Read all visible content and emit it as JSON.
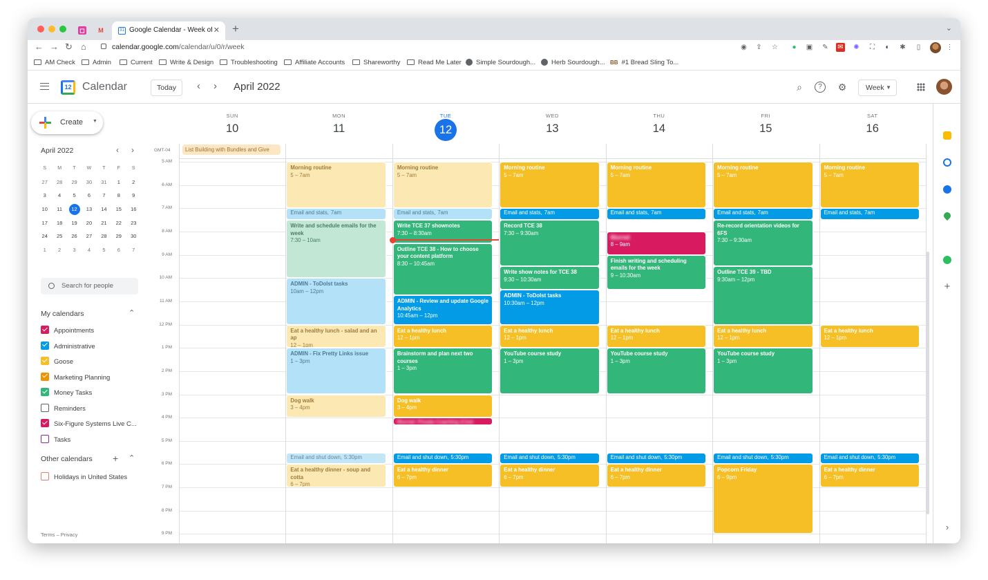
{
  "browser": {
    "tab_title": "Google Calendar - Week of Ap",
    "url_host": "calendar.google.com",
    "url_path": "/calendar/u/0/r/week",
    "bookmarks": [
      "AM Check",
      "Admin",
      "Current",
      "Write & Design",
      "Troubleshooting",
      "Affiliate Accounts",
      "Shareworthy",
      "Read Me Later",
      "Simple Sourdough...",
      "Herb Sourdough...",
      "#1 Bread Sling To..."
    ]
  },
  "header": {
    "app_name": "Calendar",
    "logo_day": "12",
    "today_label": "Today",
    "month_title": "April 2022",
    "view_label": "Week"
  },
  "sidebar": {
    "create_label": "Create",
    "mini_month": "April 2022",
    "dow": [
      "S",
      "M",
      "T",
      "W",
      "T",
      "F",
      "S"
    ],
    "weeks": [
      [
        "27",
        "28",
        "29",
        "30",
        "31",
        "1",
        "2"
      ],
      [
        "3",
        "4",
        "5",
        "6",
        "7",
        "8",
        "9"
      ],
      [
        "10",
        "11",
        "12",
        "13",
        "14",
        "15",
        "16"
      ],
      [
        "17",
        "18",
        "19",
        "20",
        "21",
        "22",
        "23"
      ],
      [
        "24",
        "25",
        "26",
        "27",
        "28",
        "29",
        "30"
      ],
      [
        "1",
        "2",
        "3",
        "4",
        "5",
        "6",
        "7"
      ]
    ],
    "search_placeholder": "Search for people",
    "my_calendars_title": "My calendars",
    "my_calendars": [
      {
        "name": "Appointments",
        "color": "#d81b60",
        "checked": true
      },
      {
        "name": "Administrative",
        "color": "#039be5",
        "checked": true
      },
      {
        "name": "Goose",
        "color": "#f6bf26",
        "checked": true
      },
      {
        "name": "Marketing Planning",
        "color": "#f09300",
        "checked": true
      },
      {
        "name": "Money Tasks",
        "color": "#33b679",
        "checked": true
      },
      {
        "name": "Reminders",
        "color": "#616161",
        "checked": false
      },
      {
        "name": "Six-Figure Systems Live C...",
        "color": "#d81b60",
        "checked": true
      },
      {
        "name": "Tasks",
        "color": "#8e24aa",
        "checked": false
      }
    ],
    "other_calendars_title": "Other calendars",
    "other_calendars": [
      {
        "name": "Holidays in United States",
        "color": "#e67c73",
        "checked": false
      }
    ],
    "footer": "Terms – Privacy"
  },
  "week": {
    "days": [
      {
        "dow": "SUN",
        "num": "10"
      },
      {
        "dow": "MON",
        "num": "11"
      },
      {
        "dow": "TUE",
        "num": "12",
        "today": true
      },
      {
        "dow": "WED",
        "num": "13"
      },
      {
        "dow": "THU",
        "num": "14"
      },
      {
        "dow": "FRI",
        "num": "15"
      },
      {
        "dow": "SAT",
        "num": "16"
      }
    ],
    "timezone": "GMT-04",
    "times": [
      "5 AM",
      "6 AM",
      "7 AM",
      "8 AM",
      "9 AM",
      "10 AM",
      "11 AM",
      "12 PM",
      "1 PM",
      "2 PM",
      "3 PM",
      "4 PM",
      "5 PM",
      "6 PM",
      "7 PM",
      "8 PM",
      "9 PM"
    ],
    "all_day_event": "List Building with Bundles and Give",
    "events": [
      {
        "day": 1,
        "start": 5,
        "end": 7,
        "title": "Morning routine",
        "time": "5 – 7am",
        "style": "c-yp"
      },
      {
        "day": 2,
        "start": 5,
        "end": 7,
        "title": "Morning routine",
        "time": "5 – 7am",
        "style": "c-yp"
      },
      {
        "day": 3,
        "start": 5,
        "end": 7,
        "title": "Morning routine",
        "time": "5 – 7am",
        "style": "c-y"
      },
      {
        "day": 4,
        "start": 5,
        "end": 7,
        "title": "Morning routine",
        "time": "5 – 7am",
        "style": "c-y"
      },
      {
        "day": 5,
        "start": 5,
        "end": 7,
        "title": "Morning routine",
        "time": "5 – 7am",
        "style": "c-y"
      },
      {
        "day": 6,
        "start": 5,
        "end": 7,
        "title": "Morning routine",
        "time": "5 – 7am",
        "style": "c-y"
      },
      {
        "day": 1,
        "start": 7,
        "end": 7.5,
        "title": "Email and stats,",
        "time": "7am",
        "inline": true,
        "style": "c-bp"
      },
      {
        "day": 2,
        "start": 7,
        "end": 7.5,
        "title": "Email and stats,",
        "time": "7am",
        "inline": true,
        "style": "c-bp"
      },
      {
        "day": 3,
        "start": 7,
        "end": 7.5,
        "title": "Email and stats,",
        "time": "7am",
        "inline": true,
        "style": "c-b"
      },
      {
        "day": 4,
        "start": 7,
        "end": 7.5,
        "title": "Email and stats,",
        "time": "7am",
        "inline": true,
        "style": "c-b"
      },
      {
        "day": 5,
        "start": 7,
        "end": 7.5,
        "title": "Email and stats,",
        "time": "7am",
        "inline": true,
        "style": "c-b"
      },
      {
        "day": 6,
        "start": 7,
        "end": 7.5,
        "title": "Email and stats,",
        "time": "7am",
        "inline": true,
        "style": "c-b"
      },
      {
        "day": 1,
        "start": 7.5,
        "end": 10,
        "title": "Write and schedule emails for the week",
        "time": "7:30 – 10am",
        "style": "c-gp"
      },
      {
        "day": 2,
        "start": 7.5,
        "end": 8.5,
        "title": "Write TCE 37 shownotes",
        "time": "7:30 – 8:30am",
        "style": "c-g"
      },
      {
        "day": 2,
        "start": 8.5,
        "end": 10.75,
        "title": "Outline TCE 38 - How to choose your content platform",
        "time": "8:30 – 10:45am",
        "style": "c-g"
      },
      {
        "day": 2,
        "start": 10.75,
        "end": 12,
        "title": "ADMIN - Review and update Google Analytics",
        "time": "10:45am – 12pm",
        "style": "c-b"
      },
      {
        "day": 3,
        "start": 7.5,
        "end": 9.5,
        "title": "Record TCE 38",
        "time": "7:30 – 9:30am",
        "style": "c-g"
      },
      {
        "day": 3,
        "start": 9.5,
        "end": 10.5,
        "title": "Write show notes for TCE 38",
        "time": "9:30 – 10:30am",
        "style": "c-g"
      },
      {
        "day": 3,
        "start": 10.5,
        "end": 12,
        "title": "ADMIN - ToDoIst tasks",
        "time": "10:30am – 12pm",
        "style": "c-b"
      },
      {
        "day": 4,
        "start": 8,
        "end": 9,
        "title": "Blurred",
        "time": "8 – 9am",
        "style": "c-r"
      },
      {
        "day": 4,
        "start": 9,
        "end": 10.5,
        "title": "Finish writing and scheduling emails for the week",
        "time": "9 – 10:30am",
        "style": "c-g"
      },
      {
        "day": 5,
        "start": 7.5,
        "end": 9.5,
        "title": "Re-record orientation videos for 6FS",
        "time": "7:30 – 9:30am",
        "style": "c-g"
      },
      {
        "day": 5,
        "start": 9.5,
        "end": 12,
        "title": "Outline TCE 39 - TBD",
        "time": "9:30am – 12pm",
        "style": "c-g"
      },
      {
        "day": 1,
        "start": 10,
        "end": 12,
        "title": "ADMIN - ToDoIst tasks",
        "time": "10am – 12pm",
        "style": "c-bp"
      },
      {
        "day": 1,
        "start": 12,
        "end": 13,
        "title": "Eat a healthy lunch - salad and an ap",
        "time": "12 – 1pm",
        "style": "c-yp"
      },
      {
        "day": 2,
        "start": 12,
        "end": 13,
        "title": "Eat a healthy lunch",
        "time": "12 – 1pm",
        "style": "c-y"
      },
      {
        "day": 3,
        "start": 12,
        "end": 13,
        "title": "Eat a healthy lunch",
        "time": "12 – 1pm",
        "style": "c-y"
      },
      {
        "day": 4,
        "start": 12,
        "end": 13,
        "title": "Eat a healthy lunch",
        "time": "12 – 1pm",
        "style": "c-y"
      },
      {
        "day": 5,
        "start": 12,
        "end": 13,
        "title": "Eat a healthy lunch",
        "time": "12 – 1pm",
        "style": "c-y"
      },
      {
        "day": 6,
        "start": 12,
        "end": 13,
        "title": "Eat a healthy lunch",
        "time": "12 – 1pm",
        "style": "c-y"
      },
      {
        "day": 1,
        "start": 13,
        "end": 15,
        "title": "ADMIN - Fix Pretty Links issue",
        "time": "1 – 3pm",
        "style": "c-bp"
      },
      {
        "day": 2,
        "start": 13,
        "end": 15,
        "title": "Brainstorm and plan next two courses",
        "time": "1 – 3pm",
        "style": "c-g"
      },
      {
        "day": 3,
        "start": 13,
        "end": 15,
        "title": "YouTube course study",
        "time": "1 – 3pm",
        "style": "c-g"
      },
      {
        "day": 4,
        "start": 13,
        "end": 15,
        "title": "YouTube course study",
        "time": "1 – 3pm",
        "style": "c-g"
      },
      {
        "day": 5,
        "start": 13,
        "end": 15,
        "title": "YouTube course study",
        "time": "1 – 3pm",
        "style": "c-g"
      },
      {
        "day": 1,
        "start": 15,
        "end": 16,
        "title": "Dog walk",
        "time": "3 – 4pm",
        "style": "c-yp"
      },
      {
        "day": 2,
        "start": 15,
        "end": 16,
        "title": "Dog walk",
        "time": "3 – 4pm",
        "style": "c-y"
      },
      {
        "day": 2,
        "start": 16,
        "end": 16.33,
        "title": "Blurred: Private Coaching (Cind",
        "time": "",
        "inline": true,
        "style": "c-r"
      },
      {
        "day": 1,
        "start": 17.5,
        "end": 18,
        "title": "Email and shut down,",
        "time": "5:30pm",
        "inline": true,
        "style": "c-ep"
      },
      {
        "day": 2,
        "start": 17.5,
        "end": 18,
        "title": "Email and shut down,",
        "time": "5:30pm",
        "inline": true,
        "style": "c-b"
      },
      {
        "day": 3,
        "start": 17.5,
        "end": 18,
        "title": "Email and shut down,",
        "time": "5:30pm",
        "inline": true,
        "style": "c-b"
      },
      {
        "day": 4,
        "start": 17.5,
        "end": 18,
        "title": "Email and shut down,",
        "time": "5:30pm",
        "inline": true,
        "style": "c-b"
      },
      {
        "day": 5,
        "start": 17.5,
        "end": 18,
        "title": "Email and shut down,",
        "time": "5:30pm",
        "inline": true,
        "style": "c-b"
      },
      {
        "day": 6,
        "start": 17.5,
        "end": 18,
        "title": "Email and shut down,",
        "time": "5:30pm",
        "inline": true,
        "style": "c-b"
      },
      {
        "day": 1,
        "start": 18,
        "end": 19,
        "title": "Eat a healthy dinner - soup and cotta",
        "time": "6 – 7pm",
        "style": "c-yp"
      },
      {
        "day": 2,
        "start": 18,
        "end": 19,
        "title": "Eat a healthy dinner",
        "time": "6 – 7pm",
        "style": "c-y"
      },
      {
        "day": 3,
        "start": 18,
        "end": 19,
        "title": "Eat a healthy dinner",
        "time": "6 – 7pm",
        "style": "c-y"
      },
      {
        "day": 4,
        "start": 18,
        "end": 19,
        "title": "Eat a healthy dinner",
        "time": "6 – 7pm",
        "style": "c-y"
      },
      {
        "day": 5,
        "start": 18,
        "end": 21,
        "title": "Popcorn Friday",
        "time": "6 – 9pm",
        "style": "c-y"
      },
      {
        "day": 6,
        "start": 18,
        "end": 19,
        "title": "Eat a healthy dinner",
        "time": "6 – 7pm",
        "style": "c-y"
      }
    ],
    "now_hour": 8.33
  }
}
